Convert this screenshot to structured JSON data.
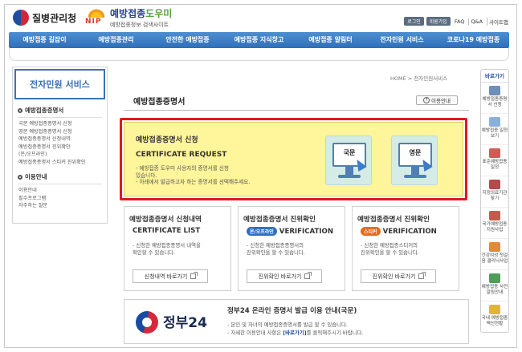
{
  "header": {
    "kdca_name": "질병관리청",
    "nip_letters": "NIP",
    "nip_title_main": "예방접종",
    "nip_title_accent": "도우미",
    "nip_subtitle": "예방접종정보 검색사이트",
    "util_buttons": [
      "로그인",
      "회원가입"
    ],
    "util_links": [
      "FAQ",
      "Q&A",
      "사이트맵"
    ]
  },
  "gnb": {
    "items": [
      "예방접종 길잡이",
      "예방접종관리",
      "안전한 예방접종",
      "예방접종 지식창고",
      "예방접종 알림터",
      "전자민원 서비스",
      "코로나19 예방접종"
    ]
  },
  "sidebar": {
    "title": "전자민원 서비스",
    "section1": "예방접종증명서",
    "section1_items": [
      "국문 예방접종증명서 신청",
      "영문 예방접종증명서 신청",
      "예방접종증명서 신청내역",
      "예방접종증명서 진위확인",
      "(온/오프라인)",
      "예방접종증명서 스티커 진위확인"
    ],
    "section2": "이용안내",
    "section2_items": [
      "이용안내",
      "필수프로그램",
      "자주하는 질문"
    ]
  },
  "breadcrumb": {
    "text": "HOME > 전자민원서비스"
  },
  "main": {
    "title": "예방접종증명서",
    "guide_label": "이용안내",
    "guide_icon_text": "?"
  },
  "certificate": {
    "title": "예방접종증명서 신청",
    "subtitle": "CERTIFICATE REQUEST",
    "desc": [
      "- 예방접종 도우미 사용자의 증명서를 신청",
      "  있습니다.",
      "- 아래에서 발급하고자 하는 증명서를 선택해주세요."
    ],
    "korean_label": "국문",
    "english_label": "영문"
  },
  "cards": [
    {
      "title": "예방접종증명서 신청내역",
      "subtitle": "CERTIFICATE LIST",
      "badge": "",
      "desc": [
        "- 신청한 예방접종증명서 내역을",
        "  확인할 수 있습니다."
      ],
      "button": "신청내역 바로가기"
    },
    {
      "title": "예방접종증명서 진위확인",
      "subtitle": "VERIFICATION",
      "badge": "온/오프라인",
      "desc": [
        "- 신청한 예방접종증명서의",
        "  진위확인을 할 수 있습니다."
      ],
      "button": "진위확인 바로가기"
    },
    {
      "title": "예방접종증명서 진위확인",
      "subtitle": "VERIFICATION",
      "badge": "스티커",
      "desc": [
        "- 신청한 예방접종스티커의",
        "  진위확인을 할 수 있습니다."
      ],
      "button": "진위확인 바로가기"
    }
  ],
  "gov24": {
    "logo": "정부24",
    "title": "정부24 온라인 증명서 발급 이용 안내(국문)",
    "desc1": "- 본인 및 자녀의 예방접종증명서를 발급 할 수 있습니다.",
    "desc2_prefix": "- 자세한 이용안내 사항은 ",
    "desc2_link": "[바로가기]",
    "desc2_suffix": "를 클릭해주시기 바랍니다."
  },
  "quick": {
    "title": "바로가기",
    "items": [
      {
        "label": "예방접종증명서 신청",
        "color": "#6f8fb8"
      },
      {
        "label": "예방접종 일정보기",
        "color": "#8ab0d8"
      },
      {
        "label": "표준예방접종일정",
        "color": "#d25b56"
      },
      {
        "label": "지정의료기관 찾기",
        "color": "#b44a4a"
      },
      {
        "label": "국가예방접종 지원사업",
        "color": "#c65b4b"
      },
      {
        "label": "건강여성 첫걸음 클리닉사업",
        "color": "#e08a3a"
      },
      {
        "label": "예방접종 사전알림안내",
        "color": "#4f9e58"
      },
      {
        "label": "국내 예방접종 백신현황",
        "color": "#e2b43c"
      }
    ]
  }
}
